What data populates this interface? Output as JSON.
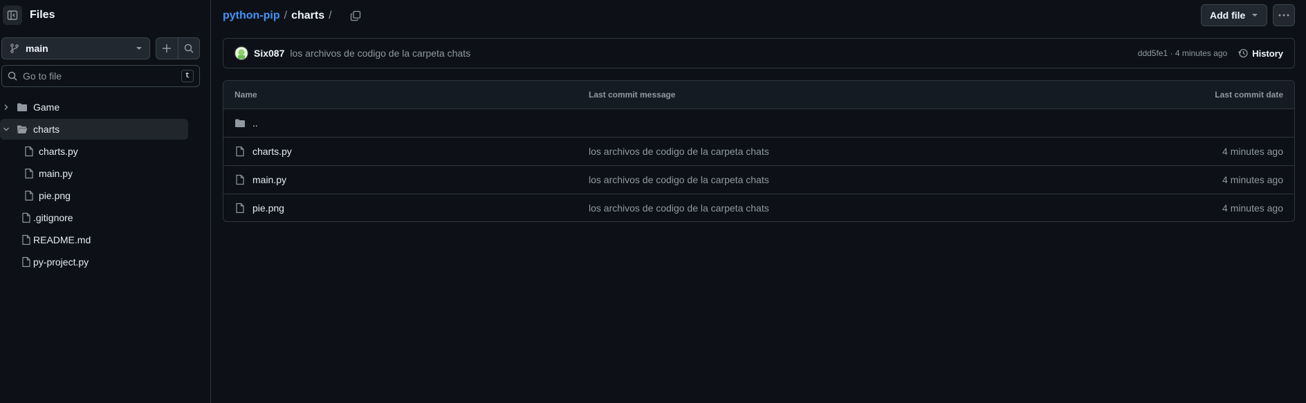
{
  "sidebar": {
    "title": "Files",
    "branch": "main",
    "search_placeholder": "Go to file",
    "search_shortcut": "t",
    "tree": [
      {
        "label": "Game",
        "type": "folder",
        "expanded": false,
        "depth": 0
      },
      {
        "label": "charts",
        "type": "folder",
        "expanded": true,
        "depth": 0,
        "selected": true
      },
      {
        "label": "charts.py",
        "type": "file",
        "depth": 1
      },
      {
        "label": "main.py",
        "type": "file",
        "depth": 1
      },
      {
        "label": "pie.png",
        "type": "file",
        "depth": 1
      },
      {
        "label": ".gitignore",
        "type": "file",
        "depth": 0
      },
      {
        "label": "README.md",
        "type": "file",
        "depth": 0
      },
      {
        "label": "py-project.py",
        "type": "file",
        "depth": 0
      }
    ]
  },
  "breadcrumb": {
    "repo": "python-pip",
    "separator": "/",
    "current": "charts",
    "trailing": "/"
  },
  "toolbar": {
    "add_file_label": "Add file"
  },
  "commit": {
    "author": "Six087",
    "message": "los archivos de codigo de la carpeta chats",
    "meta": "ddd5fe1 · 4 minutes ago",
    "history_label": "History"
  },
  "table": {
    "headers": {
      "name": "Name",
      "message": "Last commit message",
      "date": "Last commit date"
    },
    "parent_label": "..",
    "rows": [
      {
        "name": "charts.py",
        "message": "los archivos de codigo de la carpeta chats",
        "date": "4 minutes ago"
      },
      {
        "name": "main.py",
        "message": "los archivos de codigo de la carpeta chats",
        "date": "4 minutes ago"
      },
      {
        "name": "pie.png",
        "message": "los archivos de codigo de la carpeta chats",
        "date": "4 minutes ago"
      }
    ]
  },
  "colors": {
    "background": "#0d1117",
    "accent_link": "#4493f8",
    "muted_text": "#9198a1",
    "border": "#30363d"
  }
}
